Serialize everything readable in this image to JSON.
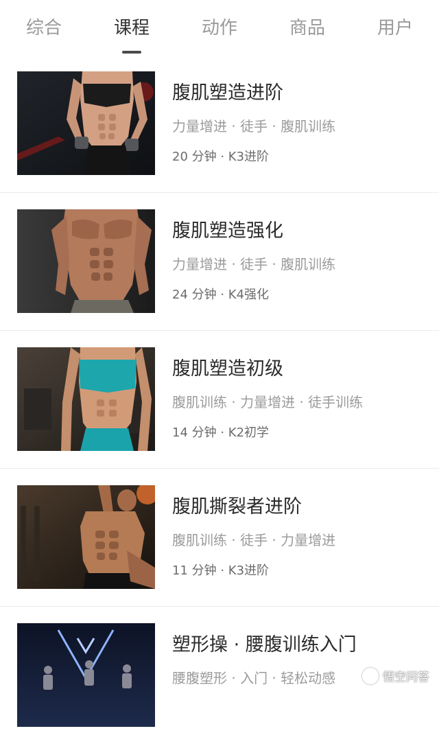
{
  "tabs": [
    {
      "label": "综合"
    },
    {
      "label": "课程"
    },
    {
      "label": "动作"
    },
    {
      "label": "商品"
    },
    {
      "label": "用户"
    }
  ],
  "active_tab": "课程",
  "courses": [
    {
      "title": "腹肌塑造进阶",
      "tags": "力量增进 · 徒手 · 腹肌训练",
      "meta": "20 分钟 · K3进阶"
    },
    {
      "title": "腹肌塑造强化",
      "tags": "力量增进 · 徒手 · 腹肌训练",
      "meta": "24 分钟 · K4强化"
    },
    {
      "title": "腹肌塑造初级",
      "tags": "腹肌训练 · 力量增进 · 徒手训练",
      "meta": "14 分钟 · K2初学"
    },
    {
      "title": "腹肌撕裂者进阶",
      "tags": "腹肌训练 · 徒手 · 力量增进",
      "meta": "11 分钟 · K3进阶"
    },
    {
      "title": "塑形操 · 腰腹训练入门",
      "tags": "腰腹塑形 · 入门 · 轻松动感",
      "meta": ""
    }
  ],
  "watermark": "悟空问答"
}
